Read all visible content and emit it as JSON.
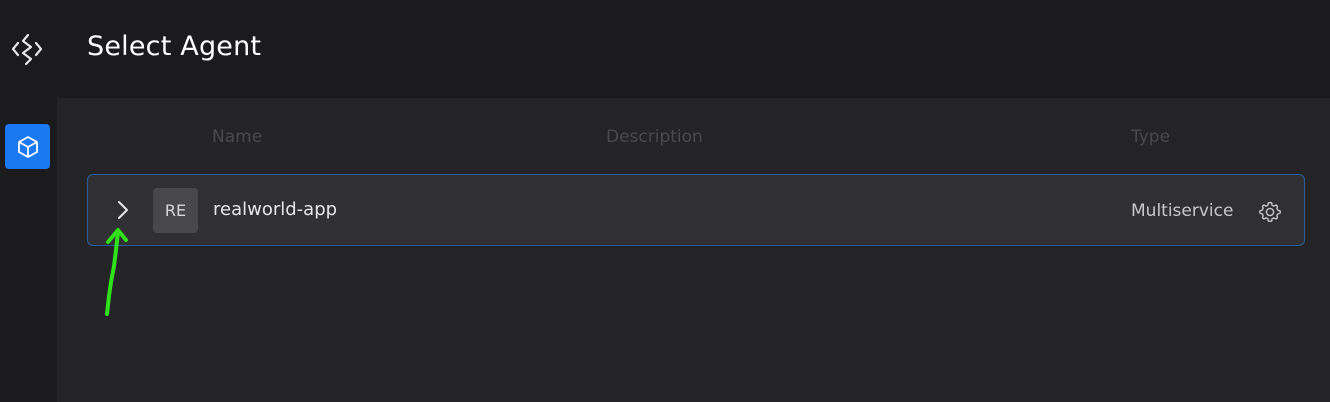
{
  "header": {
    "title": "Select Agent",
    "logo_icon": "diamond-logo-icon"
  },
  "sidebar": {
    "items": [
      {
        "icon": "cube-icon",
        "active": true
      }
    ],
    "accent_color": "#1a78f0"
  },
  "table": {
    "columns": [
      "Name",
      "Description",
      "Type"
    ],
    "rows": [
      {
        "avatar": "RE",
        "name": "realworld-app",
        "description": "",
        "type": "Multiservice",
        "expand_icon": "chevron-right-icon",
        "settings_icon": "gear-icon"
      }
    ]
  },
  "annotation": {
    "color": "#2fe01a",
    "icon": "hand-drawn-arrow-icon"
  }
}
